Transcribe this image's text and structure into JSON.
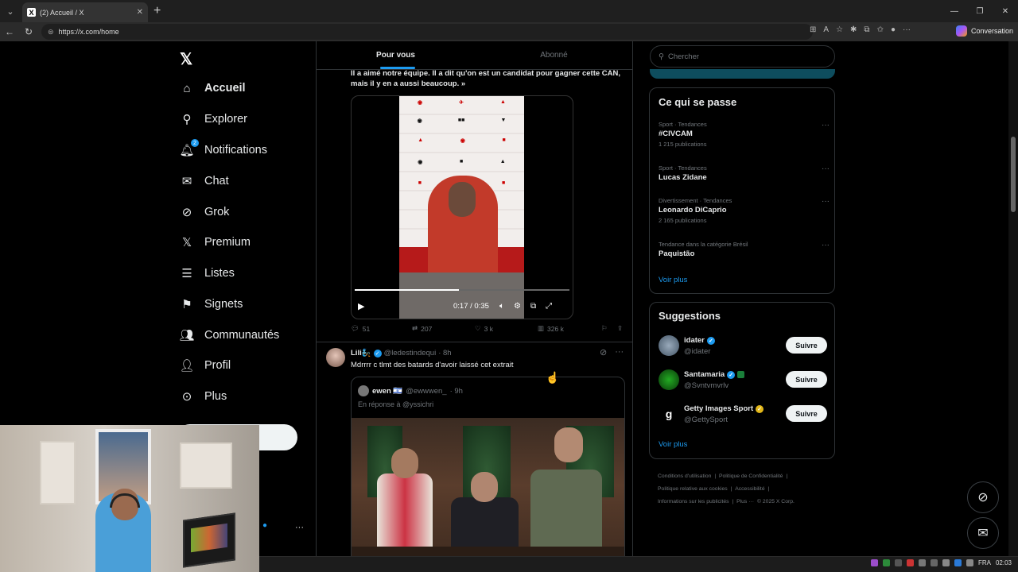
{
  "browser": {
    "tab_title": "(2) Accueil / X",
    "url": "https://x.com/home",
    "conversation_label": "Conversation"
  },
  "nav": {
    "items": [
      {
        "label": "Accueil",
        "icon": "home-icon",
        "active": true
      },
      {
        "label": "Explorer",
        "icon": "search-icon"
      },
      {
        "label": "Notifications",
        "icon": "bell-icon",
        "badge": "2"
      },
      {
        "label": "Chat",
        "icon": "mail-icon"
      },
      {
        "label": "Grok",
        "icon": "grok-icon"
      },
      {
        "label": "Premium",
        "icon": "x-icon"
      },
      {
        "label": "Listes",
        "icon": "list-icon"
      },
      {
        "label": "Signets",
        "icon": "bookmark-icon"
      },
      {
        "label": "Communautés",
        "icon": "people-icon"
      },
      {
        "label": "Profil",
        "icon": "person-icon"
      },
      {
        "label": "Plus",
        "icon": "more-icon"
      }
    ]
  },
  "feed": {
    "tabs": [
      "Pour vous",
      "Abonné"
    ],
    "active_tab": "Pour vous",
    "post1": {
      "quote_line1": "Il a aimé notre équipe. Il a dit qu'on est un candidat pour gagner cette CAN,",
      "quote_line2": "mais il y en a aussi beaucoup. »",
      "video_time": "0:17 / 0:35",
      "video_progress": 0.486,
      "replies": "51",
      "reposts": "207",
      "likes": "3 k",
      "views": "326 k"
    },
    "post2": {
      "name": "Lili🧞",
      "handle": "@ledestindequi",
      "time": "· 8h",
      "text": "Mdrrrr c tlmt des batards d'avoir laissé cet extrait",
      "quote": {
        "name": "ewen 🇮🇱",
        "handle": "@ewwwen_",
        "time": "· 9h",
        "reply_to": "En réponse à @yssichri"
      }
    }
  },
  "right": {
    "search_placeholder": "Chercher",
    "trends_title": "Ce qui se passe",
    "trends": [
      {
        "context": "Sport · Tendances",
        "title": "#CIVCAM",
        "count": "1 215 publications"
      },
      {
        "context": "Sport · Tendances",
        "title": "Lucas Zidane",
        "count": ""
      },
      {
        "context": "Divertissement · Tendances",
        "title": "Leonardo DiCaprio",
        "count": "2 165 publications"
      },
      {
        "context": "Tendance dans la catégorie Brésil",
        "title": "Paquistão",
        "count": ""
      }
    ],
    "see_more": "Voir plus",
    "suggestions_title": "Suggestions",
    "suggestions": [
      {
        "name": "idater",
        "handle": "@idater",
        "button": "Suivre"
      },
      {
        "name": "Santamaria",
        "handle": "@Svntvmvrlv",
        "button": "Suivre"
      },
      {
        "name": "Getty Images Sport",
        "handle": "@GettySport",
        "button": "Suivre"
      }
    ],
    "footer": {
      "l1a": "Conditions d'utilisation",
      "l1b": "Politique de Confidentialité",
      "l2a": "Politique relative aux cookies",
      "l2b": "Accessibilité",
      "l3a": "Informations sur les publicités",
      "l3b": "Plus ···",
      "l3c": "© 2025 X Corp."
    }
  },
  "taskbar": {
    "lang": "FRA",
    "time": "02:03"
  }
}
